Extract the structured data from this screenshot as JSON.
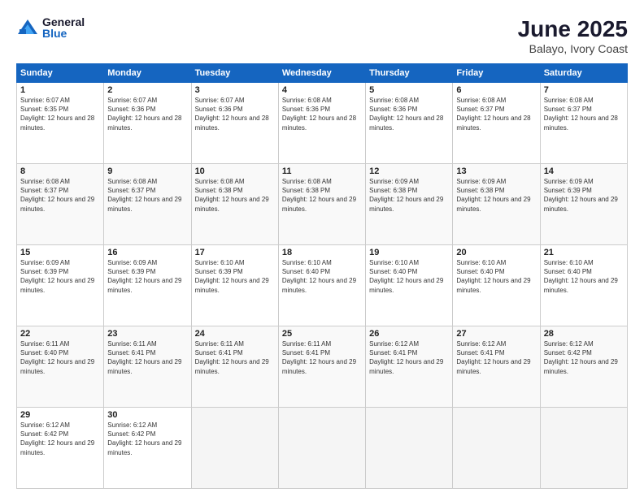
{
  "header": {
    "logo_general": "General",
    "logo_blue": "Blue",
    "month_year": "June 2025",
    "location": "Balayo, Ivory Coast"
  },
  "days_of_week": [
    "Sunday",
    "Monday",
    "Tuesday",
    "Wednesday",
    "Thursday",
    "Friday",
    "Saturday"
  ],
  "weeks": [
    [
      {
        "day": "1",
        "sunrise": "6:07 AM",
        "sunset": "6:35 PM",
        "daylight": "12 hours and 28 minutes."
      },
      {
        "day": "2",
        "sunrise": "6:07 AM",
        "sunset": "6:36 PM",
        "daylight": "12 hours and 28 minutes."
      },
      {
        "day": "3",
        "sunrise": "6:07 AM",
        "sunset": "6:36 PM",
        "daylight": "12 hours and 28 minutes."
      },
      {
        "day": "4",
        "sunrise": "6:08 AM",
        "sunset": "6:36 PM",
        "daylight": "12 hours and 28 minutes."
      },
      {
        "day": "5",
        "sunrise": "6:08 AM",
        "sunset": "6:36 PM",
        "daylight": "12 hours and 28 minutes."
      },
      {
        "day": "6",
        "sunrise": "6:08 AM",
        "sunset": "6:37 PM",
        "daylight": "12 hours and 28 minutes."
      },
      {
        "day": "7",
        "sunrise": "6:08 AM",
        "sunset": "6:37 PM",
        "daylight": "12 hours and 28 minutes."
      }
    ],
    [
      {
        "day": "8",
        "sunrise": "6:08 AM",
        "sunset": "6:37 PM",
        "daylight": "12 hours and 29 minutes."
      },
      {
        "day": "9",
        "sunrise": "6:08 AM",
        "sunset": "6:37 PM",
        "daylight": "12 hours and 29 minutes."
      },
      {
        "day": "10",
        "sunrise": "6:08 AM",
        "sunset": "6:38 PM",
        "daylight": "12 hours and 29 minutes."
      },
      {
        "day": "11",
        "sunrise": "6:08 AM",
        "sunset": "6:38 PM",
        "daylight": "12 hours and 29 minutes."
      },
      {
        "day": "12",
        "sunrise": "6:09 AM",
        "sunset": "6:38 PM",
        "daylight": "12 hours and 29 minutes."
      },
      {
        "day": "13",
        "sunrise": "6:09 AM",
        "sunset": "6:38 PM",
        "daylight": "12 hours and 29 minutes."
      },
      {
        "day": "14",
        "sunrise": "6:09 AM",
        "sunset": "6:39 PM",
        "daylight": "12 hours and 29 minutes."
      }
    ],
    [
      {
        "day": "15",
        "sunrise": "6:09 AM",
        "sunset": "6:39 PM",
        "daylight": "12 hours and 29 minutes."
      },
      {
        "day": "16",
        "sunrise": "6:09 AM",
        "sunset": "6:39 PM",
        "daylight": "12 hours and 29 minutes."
      },
      {
        "day": "17",
        "sunrise": "6:10 AM",
        "sunset": "6:39 PM",
        "daylight": "12 hours and 29 minutes."
      },
      {
        "day": "18",
        "sunrise": "6:10 AM",
        "sunset": "6:40 PM",
        "daylight": "12 hours and 29 minutes."
      },
      {
        "day": "19",
        "sunrise": "6:10 AM",
        "sunset": "6:40 PM",
        "daylight": "12 hours and 29 minutes."
      },
      {
        "day": "20",
        "sunrise": "6:10 AM",
        "sunset": "6:40 PM",
        "daylight": "12 hours and 29 minutes."
      },
      {
        "day": "21",
        "sunrise": "6:10 AM",
        "sunset": "6:40 PM",
        "daylight": "12 hours and 29 minutes."
      }
    ],
    [
      {
        "day": "22",
        "sunrise": "6:11 AM",
        "sunset": "6:40 PM",
        "daylight": "12 hours and 29 minutes."
      },
      {
        "day": "23",
        "sunrise": "6:11 AM",
        "sunset": "6:41 PM",
        "daylight": "12 hours and 29 minutes."
      },
      {
        "day": "24",
        "sunrise": "6:11 AM",
        "sunset": "6:41 PM",
        "daylight": "12 hours and 29 minutes."
      },
      {
        "day": "25",
        "sunrise": "6:11 AM",
        "sunset": "6:41 PM",
        "daylight": "12 hours and 29 minutes."
      },
      {
        "day": "26",
        "sunrise": "6:12 AM",
        "sunset": "6:41 PM",
        "daylight": "12 hours and 29 minutes."
      },
      {
        "day": "27",
        "sunrise": "6:12 AM",
        "sunset": "6:41 PM",
        "daylight": "12 hours and 29 minutes."
      },
      {
        "day": "28",
        "sunrise": "6:12 AM",
        "sunset": "6:42 PM",
        "daylight": "12 hours and 29 minutes."
      }
    ],
    [
      {
        "day": "29",
        "sunrise": "6:12 AM",
        "sunset": "6:42 PM",
        "daylight": "12 hours and 29 minutes."
      },
      {
        "day": "30",
        "sunrise": "6:12 AM",
        "sunset": "6:42 PM",
        "daylight": "12 hours and 29 minutes."
      },
      null,
      null,
      null,
      null,
      null
    ]
  ]
}
